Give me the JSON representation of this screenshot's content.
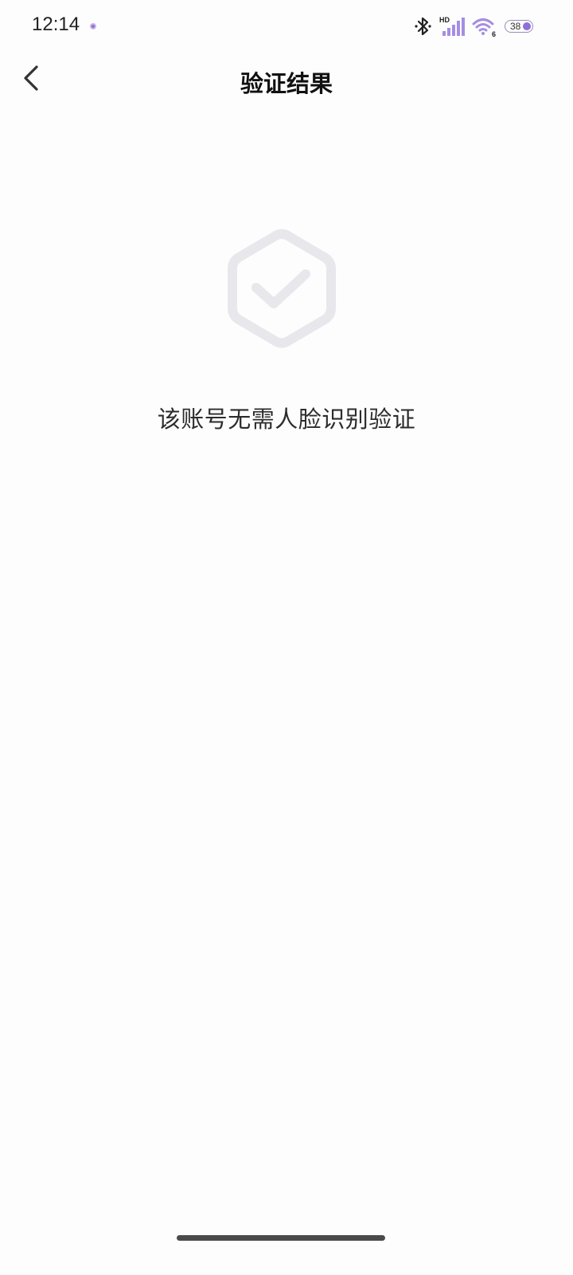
{
  "status_bar": {
    "time": "12:14",
    "network_badge": "HD",
    "wifi_badge": "6",
    "battery": "38"
  },
  "header": {
    "title": "验证结果",
    "back_icon": "chevron-left-icon"
  },
  "main": {
    "icon": "shield-check-icon",
    "message": "该账号无需人脸识别验证"
  },
  "colors": {
    "background": "#fdfdfe",
    "icon_gray": "#e8e8ec",
    "battery_accent": "#8e6fd8"
  }
}
